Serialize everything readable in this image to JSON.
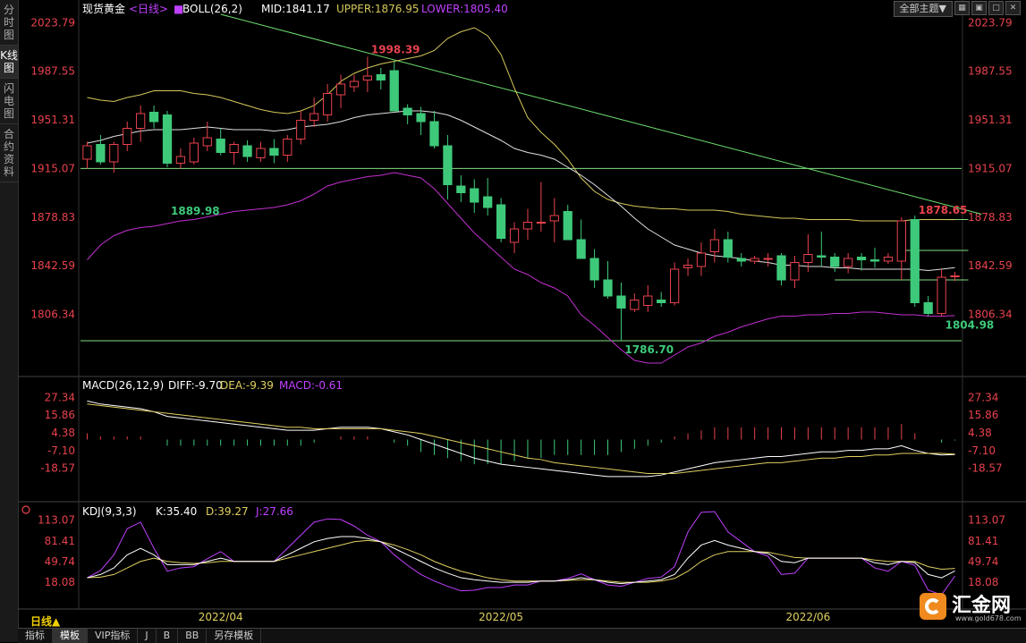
{
  "sidebar": {
    "tabs": [
      {
        "label": "分时图",
        "active": false
      },
      {
        "label": "K线图",
        "active": true
      },
      {
        "label": "闪电图",
        "active": false
      },
      {
        "label": "合约资料",
        "active": false
      }
    ]
  },
  "header": {
    "instrument": "现货黄金",
    "period_tag": "<日线>",
    "boll": {
      "label": "BOLL(26,2)",
      "mid": "MID:1841.17",
      "upper": "UPPER:1876.95",
      "lower": "LOWER:1805.40"
    },
    "theme_button": "全部主题▼"
  },
  "colors": {
    "up": "#e8424d",
    "down": "#3ec97a",
    "mid": "#e0e0e0",
    "upper": "#d4c85a",
    "lower": "#c22fd0",
    "trend": "#6fe06f",
    "hline": "#7fe07f",
    "price_axis": "#e8424d",
    "dif": "#ffffff",
    "dea": "#e0d060",
    "macd_label": "#c040ff",
    "kdj_k": "#ffffff",
    "kdj_d": "#e0d060",
    "kdj_j": "#c040ff"
  },
  "macd_header": {
    "label": "MACD(26,12,9)",
    "diff": "DIFF:-9.70",
    "dea": "DEA:-9.39",
    "macd": "MACD:-0.61"
  },
  "kdj_header": {
    "label": "KDJ(9,3,3)",
    "k": "K:35.40",
    "d": "D:39.27",
    "j": "J:27.66"
  },
  "footer": {
    "period_label": "日线▲",
    "tabs": [
      "指标",
      "模板",
      "VIP指标",
      "J",
      "B",
      "BB",
      "另存模板"
    ],
    "active_tab": "模板"
  },
  "watermark": {
    "name": "汇金网",
    "url": "www.gold678.com"
  },
  "chart_data": [
    {
      "type": "candlestick",
      "title": "现货黄金 日线",
      "x_labels": [
        "2022/04",
        "2022/05",
        "2022/06"
      ],
      "x_label_index": [
        10,
        31,
        54
      ],
      "y_ticks": [
        2023.79,
        1987.55,
        1951.31,
        1915.07,
        1878.83,
        1842.59,
        1806.34
      ],
      "ylim": [
        1770,
        2030
      ],
      "horizontal_levels": [
        1915.07,
        1786.7
      ],
      "annotations": [
        {
          "text": "1998.39",
          "index": 21,
          "value": 1998.39,
          "color": "up"
        },
        {
          "text": "1889.98",
          "index": 6,
          "value": 1889.98,
          "color": "down"
        },
        {
          "text": "1786.70",
          "index": 40,
          "value": 1786.7,
          "color": "down"
        },
        {
          "text": "1878.65",
          "index": 62,
          "value": 1878.65,
          "color": "up"
        },
        {
          "text": "1804.98",
          "index": 64,
          "value": 1804.98,
          "color": "down"
        }
      ],
      "candles": [
        [
          1922,
          1935,
          1915,
          1932
        ],
        [
          1933,
          1940,
          1918,
          1920
        ],
        [
          1920,
          1935,
          1912,
          1933
        ],
        [
          1933,
          1950,
          1928,
          1945
        ],
        [
          1945,
          1962,
          1935,
          1956
        ],
        [
          1957,
          1962,
          1945,
          1950
        ],
        [
          1955,
          1958,
          1916,
          1919
        ],
        [
          1919,
          1930,
          1915,
          1924
        ],
        [
          1920,
          1938,
          1918,
          1934
        ],
        [
          1932,
          1950,
          1928,
          1938
        ],
        [
          1937,
          1945,
          1925,
          1927
        ],
        [
          1927,
          1935,
          1918,
          1933
        ],
        [
          1932,
          1936,
          1920,
          1924
        ],
        [
          1923,
          1935,
          1920,
          1930
        ],
        [
          1930,
          1937,
          1919,
          1925
        ],
        [
          1925,
          1940,
          1920,
          1937
        ],
        [
          1937,
          1958,
          1933,
          1951
        ],
        [
          1951,
          1968,
          1946,
          1956
        ],
        [
          1955,
          1978,
          1950,
          1971
        ],
        [
          1970,
          1985,
          1960,
          1978
        ],
        [
          1976,
          1985,
          1972,
          1980
        ],
        [
          1981,
          1998.39,
          1972,
          1984
        ],
        [
          1985,
          1990,
          1974,
          1981
        ],
        [
          1988,
          1995,
          1972,
          1958
        ],
        [
          1960,
          1963,
          1948,
          1955
        ],
        [
          1956,
          1961,
          1940,
          1950
        ],
        [
          1950,
          1958,
          1930,
          1932
        ],
        [
          1932,
          1940,
          1892,
          1903
        ],
        [
          1902,
          1910,
          1890,
          1897
        ],
        [
          1900,
          1907,
          1882,
          1890
        ],
        [
          1894,
          1908,
          1880,
          1886
        ],
        [
          1888,
          1893,
          1860,
          1863
        ],
        [
          1860,
          1875,
          1852,
          1870
        ],
        [
          1870,
          1885,
          1862,
          1875
        ],
        [
          1875,
          1905,
          1868,
          1875
        ],
        [
          1876,
          1893,
          1860,
          1880
        ],
        [
          1883,
          1888,
          1865,
          1862
        ],
        [
          1862,
          1877,
          1852,
          1848
        ],
        [
          1848,
          1855,
          1826,
          1832
        ],
        [
          1832,
          1846,
          1818,
          1820
        ],
        [
          1820,
          1830,
          1786.7,
          1811
        ],
        [
          1810,
          1822,
          1808,
          1817
        ],
        [
          1813,
          1828,
          1808,
          1820
        ],
        [
          1817,
          1823,
          1812,
          1815
        ],
        [
          1815,
          1845,
          1813,
          1840
        ],
        [
          1841,
          1848,
          1835,
          1843
        ],
        [
          1842,
          1860,
          1835,
          1852
        ],
        [
          1853,
          1870,
          1845,
          1862
        ],
        [
          1862,
          1868,
          1845,
          1849
        ],
        [
          1848,
          1852,
          1842,
          1846
        ],
        [
          1846,
          1850,
          1844,
          1848
        ],
        [
          1848,
          1852,
          1842,
          1848
        ],
        [
          1850,
          1852,
          1828,
          1832
        ],
        [
          1832,
          1850,
          1826,
          1845
        ],
        [
          1845,
          1866,
          1838,
          1851
        ],
        [
          1850,
          1868,
          1842,
          1849
        ],
        [
          1849,
          1852,
          1838,
          1842
        ],
        [
          1842,
          1852,
          1837,
          1848
        ],
        [
          1849,
          1852,
          1839,
          1847
        ],
        [
          1847,
          1856,
          1841,
          1846
        ],
        [
          1846,
          1852,
          1844,
          1849
        ],
        [
          1846,
          1878.65,
          1832,
          1876
        ],
        [
          1877,
          1880,
          1812,
          1815
        ],
        [
          1815,
          1820,
          1804.98,
          1807
        ],
        [
          1807,
          1840,
          1805,
          1834
        ],
        [
          1835,
          1838,
          1831,
          1835
        ]
      ],
      "mid": [
        1934,
        1936,
        1939,
        1941,
        1943,
        1944,
        1944,
        1944,
        1945,
        1946,
        1945,
        1944,
        1944,
        1944,
        1943,
        1944,
        1946,
        1947,
        1948,
        1950,
        1953,
        1955,
        1956,
        1957,
        1958,
        1958,
        1957,
        1955,
        1951,
        1946,
        1941,
        1936,
        1930,
        1927,
        1925,
        1922,
        1916,
        1910,
        1903,
        1895,
        1887,
        1878,
        1870,
        1864,
        1858,
        1855,
        1852,
        1850,
        1849,
        1848,
        1846,
        1845,
        1843,
        1843,
        1842,
        1842,
        1841,
        1841,
        1840,
        1840,
        1840,
        1840,
        1840,
        1839,
        1840,
        1841.17
      ],
      "upper": [
        1968,
        1966,
        1965,
        1968,
        1970,
        1973,
        1973,
        1973,
        1971,
        1970,
        1968,
        1965,
        1962,
        1959,
        1957,
        1956,
        1958,
        1962,
        1970,
        1980,
        1986,
        1990,
        1993,
        1995,
        1997,
        1999,
        2003,
        2012,
        2017,
        2020,
        2014,
        2000,
        1975,
        1953,
        1942,
        1933,
        1922,
        1908,
        1898,
        1892,
        1889,
        1887,
        1886,
        1885,
        1885,
        1884,
        1884,
        1884,
        1883,
        1881,
        1880,
        1879,
        1878,
        1878,
        1877,
        1877,
        1877,
        1877,
        1876,
        1876,
        1876,
        1876,
        1877,
        1877,
        1877,
        1876.95
      ],
      "lower": [
        1847,
        1858,
        1865,
        1869,
        1871,
        1872,
        1874,
        1876,
        1877,
        1879,
        1881,
        1883,
        1884,
        1885,
        1886,
        1888,
        1891,
        1896,
        1902,
        1905,
        1907,
        1909,
        1910,
        1912,
        1910,
        1908,
        1900,
        1889,
        1878,
        1867,
        1858,
        1849,
        1840,
        1836,
        1830,
        1826,
        1820,
        1806,
        1798,
        1789,
        1780,
        1772,
        1770,
        1770,
        1776,
        1782,
        1785,
        1790,
        1793,
        1797,
        1800,
        1803,
        1805,
        1805,
        1806,
        1806,
        1807,
        1807,
        1808,
        1808,
        1807,
        1806,
        1806,
        1805,
        1805,
        1805.4
      ],
      "trend_line": {
        "from": {
          "index": 10,
          "value": 2030
        },
        "to": {
          "index": 67,
          "value": 1881
        }
      }
    },
    {
      "type": "macd",
      "y_ticks": [
        27.34,
        15.86,
        4.38,
        -7.1,
        -18.57
      ],
      "ylim": [
        -31,
        31
      ],
      "dif": [
        25,
        23,
        22,
        21,
        20,
        18,
        15,
        14,
        13,
        12,
        11,
        10,
        9,
        8,
        7,
        6,
        6,
        6,
        7,
        8,
        8,
        8,
        7,
        5,
        3,
        0,
        -3,
        -6,
        -9,
        -12,
        -14,
        -16,
        -17,
        -18,
        -19,
        -20,
        -21,
        -22,
        -23,
        -24,
        -24,
        -24,
        -24,
        -23,
        -21,
        -19,
        -17,
        -15,
        -14,
        -13,
        -12,
        -11,
        -11,
        -10,
        -9,
        -8,
        -8,
        -7,
        -7,
        -6,
        -6,
        -4,
        -7,
        -9,
        -10,
        -9.7
      ],
      "dea": [
        23,
        22,
        21,
        20,
        19,
        18,
        17,
        16,
        15,
        14,
        13,
        12,
        11,
        10,
        9,
        8,
        8,
        7,
        7,
        7,
        7,
        7,
        7,
        6,
        5,
        4,
        2,
        0,
        -2,
        -4,
        -6,
        -8,
        -10,
        -12,
        -13,
        -15,
        -16,
        -17,
        -18,
        -19,
        -20,
        -21,
        -22,
        -22,
        -22,
        -21,
        -20,
        -19,
        -18,
        -17,
        -16,
        -15,
        -15,
        -14,
        -13,
        -12,
        -12,
        -11,
        -11,
        -10,
        -10,
        -9,
        -9,
        -9,
        -9,
        -9.39
      ],
      "macd": [
        4,
        2,
        2,
        2,
        2,
        0,
        -4,
        -4,
        -4,
        -4,
        -4,
        -4,
        -4,
        -4,
        -4,
        -4,
        -4,
        -2,
        0,
        2,
        2,
        2,
        0,
        -2,
        -4,
        -8,
        -10,
        -12,
        -14,
        -16,
        -16,
        -16,
        -14,
        -12,
        -12,
        -10,
        -10,
        -10,
        -10,
        -10,
        -8,
        -6,
        -4,
        -2,
        2,
        4,
        6,
        8,
        8,
        8,
        8,
        8,
        8,
        8,
        8,
        8,
        8,
        8,
        8,
        8,
        8,
        10,
        4,
        0,
        -2,
        -0.61
      ]
    },
    {
      "type": "kdj",
      "y_ticks": [
        113.07,
        81.41,
        49.74,
        18.08
      ],
      "ylim": [
        -5,
        118
      ],
      "k": [
        25,
        30,
        40,
        60,
        70,
        60,
        45,
        45,
        45,
        50,
        55,
        50,
        50,
        50,
        50,
        60,
        70,
        80,
        85,
        88,
        88,
        85,
        80,
        70,
        60,
        50,
        40,
        32,
        25,
        22,
        20,
        18,
        18,
        18,
        20,
        20,
        22,
        25,
        22,
        18,
        16,
        18,
        20,
        22,
        30,
        55,
        75,
        82,
        75,
        70,
        65,
        62,
        50,
        48,
        55,
        55,
        55,
        55,
        55,
        48,
        45,
        50,
        48,
        30,
        25,
        35.4
      ],
      "d": [
        25,
        26,
        30,
        40,
        50,
        55,
        50,
        48,
        47,
        48,
        50,
        50,
        50,
        50,
        50,
        55,
        60,
        65,
        70,
        75,
        80,
        82,
        80,
        75,
        68,
        60,
        50,
        42,
        35,
        30,
        25,
        22,
        20,
        20,
        20,
        20,
        21,
        22,
        22,
        20,
        18,
        18,
        18,
        20,
        24,
        35,
        50,
        60,
        65,
        65,
        65,
        64,
        60,
        56,
        55,
        55,
        55,
        55,
        55,
        52,
        50,
        50,
        50,
        42,
        38,
        39.27
      ],
      "j": [
        25,
        36,
        60,
        100,
        110,
        70,
        35,
        40,
        42,
        54,
        65,
        50,
        50,
        50,
        50,
        70,
        90,
        110,
        115,
        114,
        104,
        90,
        80,
        60,
        44,
        30,
        20,
        12,
        5,
        6,
        10,
        10,
        14,
        14,
        20,
        20,
        24,
        31,
        22,
        14,
        12,
        18,
        24,
        26,
        42,
        95,
        125,
        126,
        95,
        80,
        65,
        58,
        30,
        32,
        55,
        55,
        55,
        55,
        55,
        40,
        35,
        50,
        44,
        6,
        -1,
        27.66
      ]
    }
  ]
}
